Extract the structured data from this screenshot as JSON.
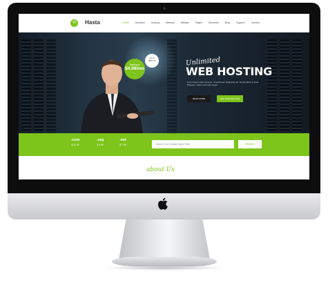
{
  "site": {
    "logo_letter": "H",
    "name": "Hasta"
  },
  "nav": {
    "items": [
      "Home",
      "Domains",
      "Hosting",
      "Website",
      "Affiliate",
      "Pages",
      "Elements",
      "Blog",
      "Support",
      "Contact"
    ],
    "active_index": 0
  },
  "hero": {
    "price_label": "Starting at",
    "price": "$4.99/mo",
    "discount_line1": "Up to",
    "discount_line2": "50% off",
    "script_title": "Unlimited",
    "title": "WEB HOSTING",
    "description": "Lorem ipsum dolor sit amet, consectetuer adipiscing elit. Suspendisse et justo. Praesent mattis commodo augue.",
    "read_more_label": "READ MORE",
    "get_started_label": "GET STARTED NOW"
  },
  "domains": [
    {
      "ext": ".com",
      "price": "$ 11.99"
    },
    {
      "ext": ".org",
      "price": "$ 9.99"
    },
    {
      "ext": ".net",
      "price": "$ 7.99"
    }
  ],
  "search": {
    "placeholder": "Search Your Domain Name Here",
    "button_label": "SEARCH"
  },
  "about_heading": "about Us",
  "colors": {
    "accent": "#7dc41b",
    "dark": "#1a1a1a",
    "bezel": "#0d0d0d"
  },
  "icons": {
    "brand": "apple-logo-icon"
  }
}
